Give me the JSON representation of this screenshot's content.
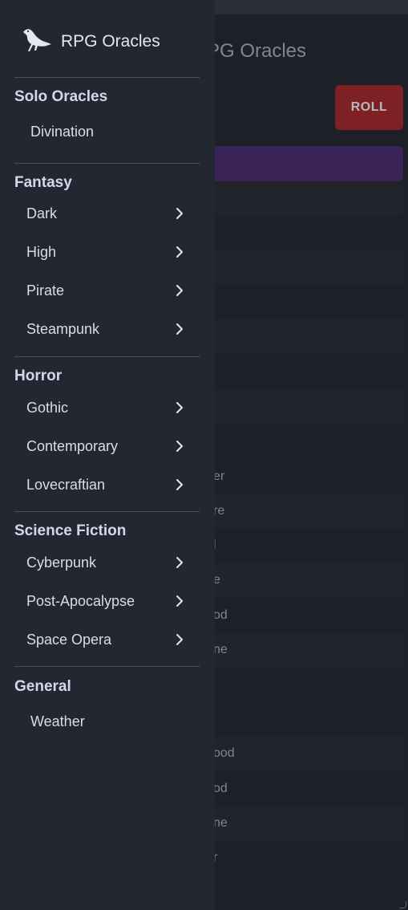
{
  "app": {
    "title": "RPG Oracles"
  },
  "background": {
    "title_partial": "PG Oracles",
    "roll_label": "ROLL",
    "row_fragments": [
      "er",
      "re",
      "l",
      "e",
      "od",
      "ne",
      "ood",
      "od",
      "ne",
      "r"
    ]
  },
  "drawer": {
    "sections": [
      {
        "title": "Solo Oracles",
        "items": [
          {
            "label": "Divination",
            "submenu": false
          }
        ]
      },
      {
        "title": "Fantasy",
        "items": [
          {
            "label": "Dark",
            "submenu": true
          },
          {
            "label": "High",
            "submenu": true
          },
          {
            "label": "Pirate",
            "submenu": true
          },
          {
            "label": "Steampunk",
            "submenu": true
          }
        ]
      },
      {
        "title": "Horror",
        "items": [
          {
            "label": "Gothic",
            "submenu": true
          },
          {
            "label": "Contemporary",
            "submenu": true
          },
          {
            "label": "Lovecraftian",
            "submenu": true
          }
        ]
      },
      {
        "title": "Science Fiction",
        "items": [
          {
            "label": "Cyberpunk",
            "submenu": true
          },
          {
            "label": "Post-Apocalypse",
            "submenu": true
          },
          {
            "label": "Space Opera",
            "submenu": true
          }
        ]
      },
      {
        "title": "General",
        "items": [
          {
            "label": "Weather",
            "submenu": false
          }
        ]
      }
    ]
  },
  "icons": {
    "brand": "raven-icon",
    "submenu": "chevron-right-icon"
  },
  "colors": {
    "drawer_bg": "#232731",
    "page_bg": "#1d2027",
    "roll_button": "#7e2124",
    "accent_bar": "#3a2356"
  }
}
